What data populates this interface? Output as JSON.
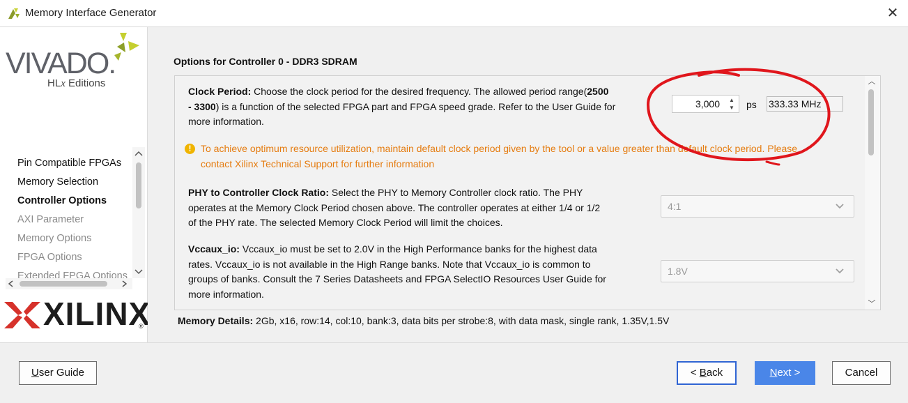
{
  "window": {
    "title": "Memory Interface Generator",
    "close_glyph": "✕"
  },
  "branding": {
    "vivado_text": "VIVADO.",
    "vivado_sub_a": "HL",
    "vivado_sub_x": "x",
    "vivado_sub_b": " Editions",
    "xilinx_text": "XILINX",
    "xilinx_reg": "®"
  },
  "sidebar": {
    "items": [
      {
        "label": "Pin Compatible FPGAs",
        "state": "normal"
      },
      {
        "label": "Memory Selection",
        "state": "normal"
      },
      {
        "label": "Controller Options",
        "state": "active"
      },
      {
        "label": "AXI Parameter",
        "state": "disabled"
      },
      {
        "label": "Memory Options",
        "state": "disabled"
      },
      {
        "label": "FPGA Options",
        "state": "disabled"
      },
      {
        "label": "Extended FPGA Options",
        "state": "disabled"
      }
    ]
  },
  "main": {
    "section_title": "Options for Controller 0 - DDR3 SDRAM",
    "clock_period": {
      "label": "Clock Period:",
      "text_a": " Choose the clock period for the desired frequency. The allowed period range(",
      "range": "2500",
      "text_b": "- 3300",
      "text_c": ") is a function of the selected FPGA part and FPGA speed grade. Refer to the User Guide for",
      "text_d": "more information.",
      "value": "3,000",
      "unit": "ps",
      "frequency": "333.33 MHz"
    },
    "warning": {
      "line1": "To achieve optimum resource utilization, maintain default clock period given by the tool or a value greater than default clock period. Please",
      "line2": "contact Xilinx Technical Support for further information"
    },
    "phy_ratio": {
      "label": "PHY to Controller Clock Ratio:",
      "line1": " Select the PHY to Memory Controller clock ratio. The PHY",
      "line2": "operates at the Memory Clock Period chosen above. The controller operates at either 1/4 or 1/2",
      "line3": "of the PHY rate. The selected Memory Clock Period will limit the choices.",
      "selected": "4:1"
    },
    "vccaux": {
      "label": "Vccaux_io:",
      "line1": " Vccaux_io must be set to 2.0V in the High Performance banks for the highest data",
      "line2": "rates. Vccaux_io is not available in the High Range banks. Note that Vccaux_io is common to",
      "line3": "groups of banks. Consult the 7 Series Datasheets and FPGA SelectIO Resources User Guide for",
      "line4": "more information.",
      "selected": "1.8V"
    },
    "memory_details": {
      "label": "Memory Details:",
      "value": " 2Gb, x16, row:14, col:10, bank:3, data bits per strobe:8, with data mask, single rank, 1.35V,1.5V"
    }
  },
  "footer": {
    "user_guide_u": "U",
    "user_guide_rest": "ser Guide",
    "back_prefix": "< ",
    "back_u": "B",
    "back_rest": "ack",
    "next_u": "N",
    "next_rest": "ext >",
    "cancel": "Cancel"
  },
  "colors": {
    "accent": "#4a86e8",
    "warning_text": "#e57c10",
    "annotation": "#e0161c"
  }
}
